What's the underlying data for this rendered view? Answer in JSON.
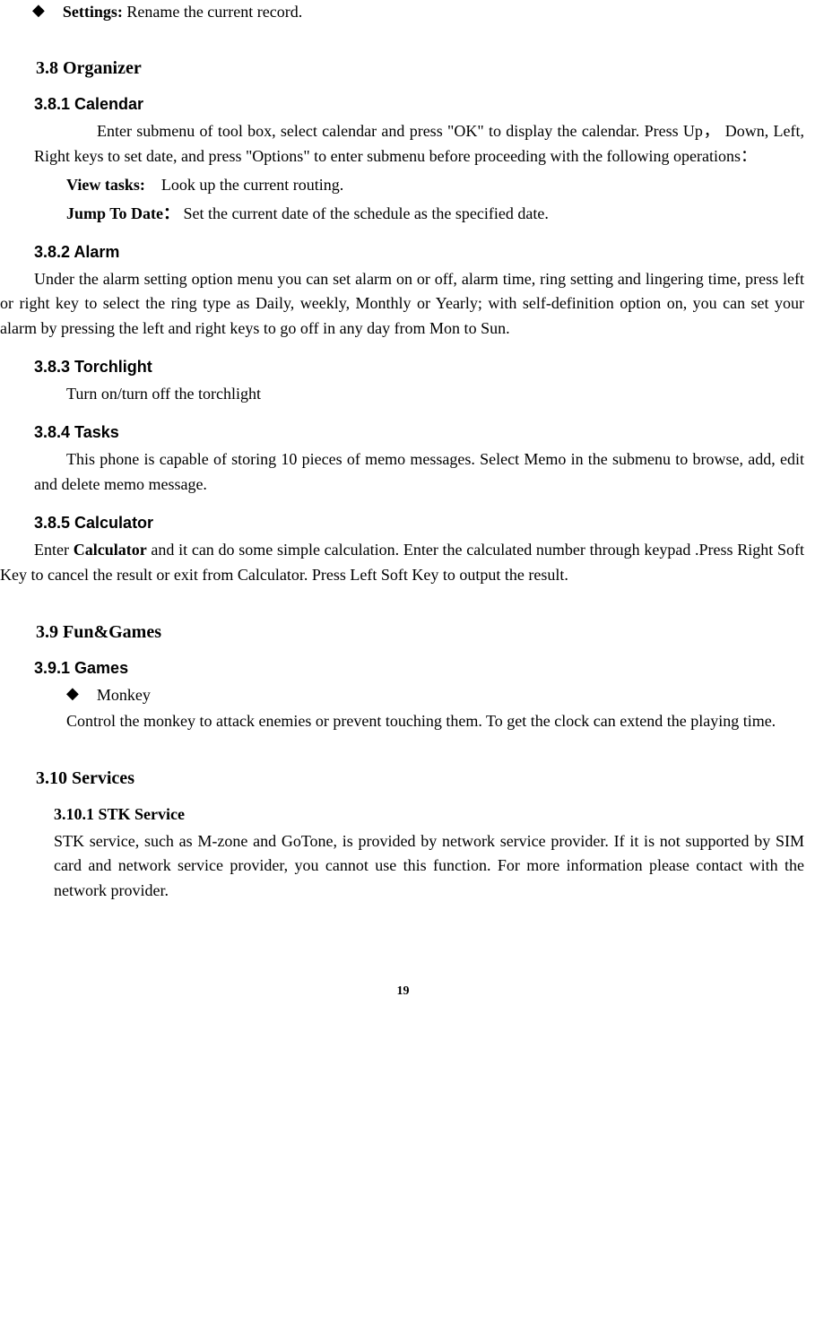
{
  "items": {
    "settings": {
      "label": "Settings:",
      "text": "Rename the current record."
    }
  },
  "sec3_8": {
    "title": "3.8 Organizer",
    "calendar": {
      "title": "3.8.1 Calendar",
      "body": "Enter submenu of tool box, select calendar and press \"OK\" to display the calendar. Press Up， Down, Left, Right keys to set date, and press \"Options\" to enter submenu before proceeding with the following operations：",
      "viewTasks": {
        "label": "View tasks:",
        "text": "Look up the current routing."
      },
      "jumpTo": {
        "label": "Jump To Date：",
        "text": "Set the current date of the schedule as the specified date."
      }
    },
    "alarm": {
      "title": "3.8.2 Alarm",
      "body": "Under the alarm setting option menu you can set alarm on or off, alarm time, ring setting and lingering time, press left or right key to select the ring type as Daily, weekly, Monthly or Yearly; with self-definition option on, you can set your alarm by pressing the left and right keys to go off in any day from Mon to Sun."
    },
    "torch": {
      "title": "3.8.3 Torchlight",
      "body": "Turn on/turn off the torchlight"
    },
    "tasks": {
      "title": "3.8.4 Tasks",
      "body": "This phone is capable of storing 10 pieces of memo messages. Select Memo in the submenu to browse, add, edit and delete memo message."
    },
    "calculator": {
      "title": "3.8.5 Calculator",
      "body_pre": "Enter ",
      "body_bold": "Calculator",
      "body_post": " and it can do some simple calculation. Enter the calculated number through keypad .Press Right Soft Key to cancel the result or exit from Calculator. Press Left Soft Key to output the result."
    }
  },
  "sec3_9": {
    "title": "3.9 Fun&Games",
    "games": {
      "title": "3.9.1 Games",
      "monkey": {
        "label": "Monkey",
        "body": "Control the monkey to attack enemies or prevent touching them. To get the clock can extend the playing time."
      }
    }
  },
  "sec3_10": {
    "title": "3.10 Services",
    "stk": {
      "title": "3.10.1 STK Service",
      "body": "STK service, such as M-zone and GoTone, is provided by network service provider. If it is not supported by SIM card and network service provider, you cannot use this function. For more information please contact with the network provider."
    }
  },
  "pageNum": "19"
}
